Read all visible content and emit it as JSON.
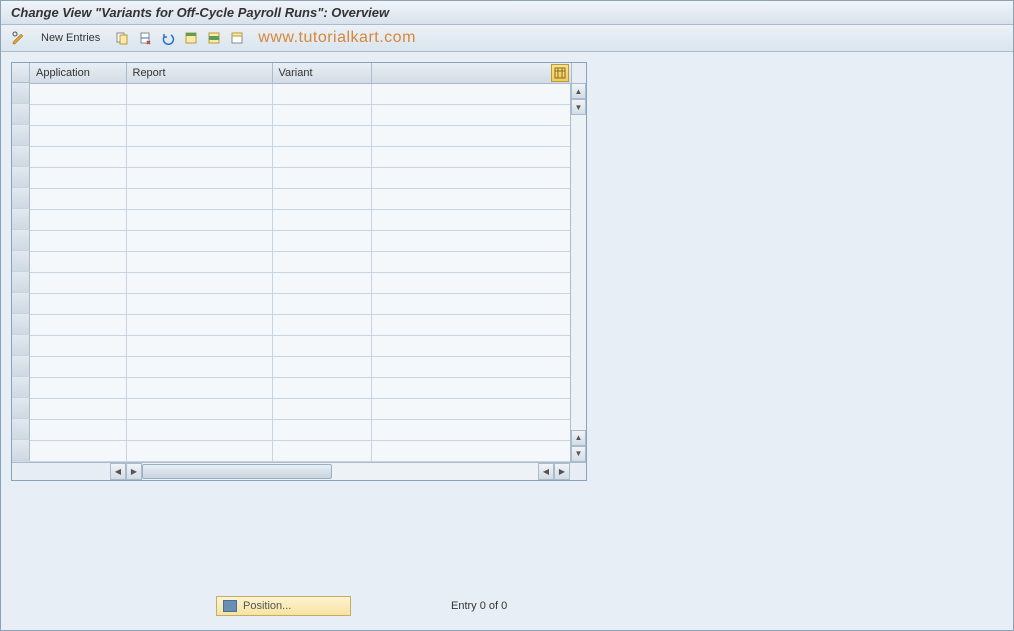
{
  "title": "Change View \"Variants for Off-Cycle Payroll Runs\": Overview",
  "toolbar": {
    "new_entries_label": "New Entries"
  },
  "watermark": "www.tutorialkart.com",
  "table": {
    "columns": [
      {
        "label": "Application",
        "width": 96
      },
      {
        "label": "Report",
        "width": 146
      },
      {
        "label": "Variant",
        "width": 99
      }
    ],
    "row_count": 18
  },
  "footer": {
    "position_label": "Position...",
    "entry_text": "Entry 0 of 0"
  }
}
